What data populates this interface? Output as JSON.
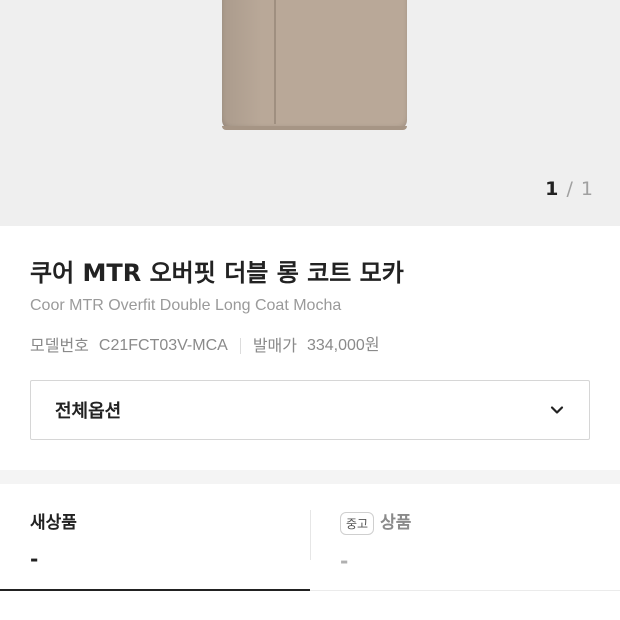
{
  "gallery": {
    "current": "1",
    "separator": "/",
    "total": "1"
  },
  "product": {
    "title_kr": "쿠어 MTR 오버핏 더블 롱 코트 모카",
    "title_en": "Coor MTR Overfit Double Long Coat Mocha",
    "model_label": "모델번호",
    "model_value": "C21FCT03V-MCA",
    "release_label": "발매가",
    "release_value": "334,000원"
  },
  "option": {
    "label": "전체옵션",
    "icon": "chevron-down-icon"
  },
  "tabs": {
    "new": {
      "title": "새상품",
      "price": "-"
    },
    "used": {
      "badge": "중고",
      "title": "상품",
      "price": "-"
    }
  },
  "colors": {
    "coat": "#b9a898",
    "image_bg": "#efefef",
    "text_primary": "#222222",
    "text_muted": "#9a9a9a"
  }
}
